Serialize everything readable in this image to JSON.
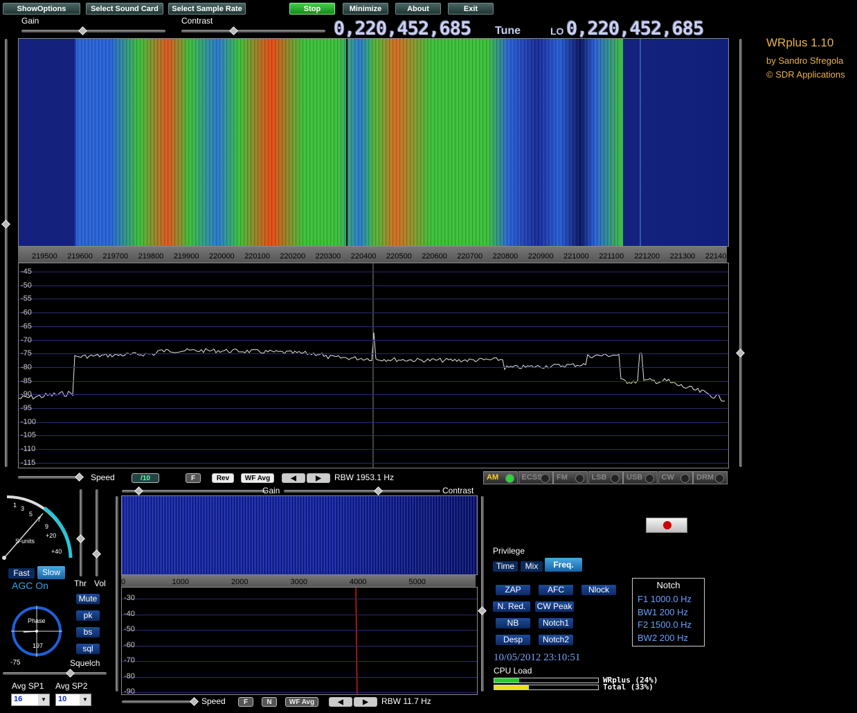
{
  "toolbar": {
    "show_options": "ShowOptions",
    "select_sound_card": "Select Sound Card",
    "select_sample_rate": "Select Sample Rate",
    "stop": "Stop",
    "minimize": "Minimize",
    "about": "About",
    "exit": "Exit"
  },
  "top_sliders": {
    "gain": "Gain",
    "contrast": "Contrast"
  },
  "frequency": {
    "tune_value": "0,220,452,685",
    "tune_label": "Tune",
    "lo_label": "LO",
    "lo_value": "0,220,452,685"
  },
  "app_info": {
    "name": "WRplus 1.10",
    "author": "by Sandro Sfregola",
    "copyright": "© SDR Applications"
  },
  "main_freq_scale": [
    "219500",
    "219600",
    "219700",
    "219800",
    "219900",
    "220000",
    "220100",
    "220200",
    "220300",
    "220400",
    "220500",
    "220600",
    "220700",
    "220800",
    "220900",
    "221000",
    "221100",
    "221200",
    "221300",
    "22140"
  ],
  "main_db_scale": [
    "-45",
    "-50",
    "-55",
    "-60",
    "-65",
    "-70",
    "-75",
    "-80",
    "-85",
    "-90",
    "-95",
    "-100",
    "-105",
    "-110",
    "-115"
  ],
  "main_controls": {
    "speed": "Speed",
    "div": "/10",
    "f": "F",
    "rev": "Rev",
    "wf_avg": "WF Avg",
    "rbw": "RBW 1953.1 Hz"
  },
  "modes": [
    {
      "label": "AM",
      "active": true
    },
    {
      "label": "ECSS",
      "active": false
    },
    {
      "label": "FM",
      "active": false
    },
    {
      "label": "LSB",
      "active": false
    },
    {
      "label": "USB",
      "active": false
    },
    {
      "label": "CW",
      "active": false
    },
    {
      "label": "DRM",
      "active": false
    }
  ],
  "smeter": {
    "ticks": [
      "1",
      "3",
      "5",
      "7",
      "9",
      "+20",
      "+40"
    ],
    "label": "S-units"
  },
  "agc": {
    "fast": "Fast",
    "slow": "Slow",
    "status": "AGC On",
    "thr": "Thr",
    "vol": "Vol"
  },
  "audio_buttons": {
    "mute": "Mute",
    "pk": "pk",
    "bs": "bs",
    "sql": "sql"
  },
  "phase": {
    "label": "Phase",
    "value": "197",
    "level": "-75",
    "squelch": "Squelch"
  },
  "averaging": {
    "sp1_label": "Avg SP1",
    "sp1_value": "16",
    "sp2_label": "Avg SP2",
    "sp2_value": "10"
  },
  "audio_sliders": {
    "gain": "Gain",
    "contrast": "Contrast"
  },
  "audio_freq_scale": [
    "0",
    "1000",
    "2000",
    "3000",
    "4000",
    "5000"
  ],
  "audio_db_scale": [
    "-30",
    "-40",
    "-50",
    "-60",
    "-70",
    "-80",
    "-90"
  ],
  "audio_controls": {
    "speed": "Speed",
    "f": "F",
    "n": "N",
    "wf_avg": "WF Avg",
    "rbw": "RBW 11.7 Hz"
  },
  "privilege": {
    "title": "Privilege",
    "time": "Time",
    "mix": "Mix",
    "freq": "Freq."
  },
  "dsp_buttons": {
    "zap": "ZAP",
    "afc": "AFC",
    "nlock": "Nlock",
    "nred": "N. Red.",
    "cwpeak": "CW Peak",
    "nb": "NB",
    "notch1": "Notch1",
    "desp": "Desp",
    "notch2": "Notch2"
  },
  "notch": {
    "title": "Notch",
    "f1": "F1 1000.0 Hz",
    "bw1": "BW1  200 Hz",
    "f2": "F2 1500.0 Hz",
    "bw2": "BW2  200 Hz"
  },
  "status": {
    "datetime": "10/05/2012 23:10:51",
    "cpu_label": "CPU Load",
    "wrplus_load": "WRplus (24%)",
    "total_load": "Total   (33%)",
    "wrplus_pct": 24,
    "total_pct": 33
  },
  "colors": {
    "accent_gold": "#e8b34a",
    "freq_text": "#c9cff5",
    "waterfall_bg": "#10207a",
    "trace": "#e6e6e6",
    "marker_red": "#ff2020"
  }
}
